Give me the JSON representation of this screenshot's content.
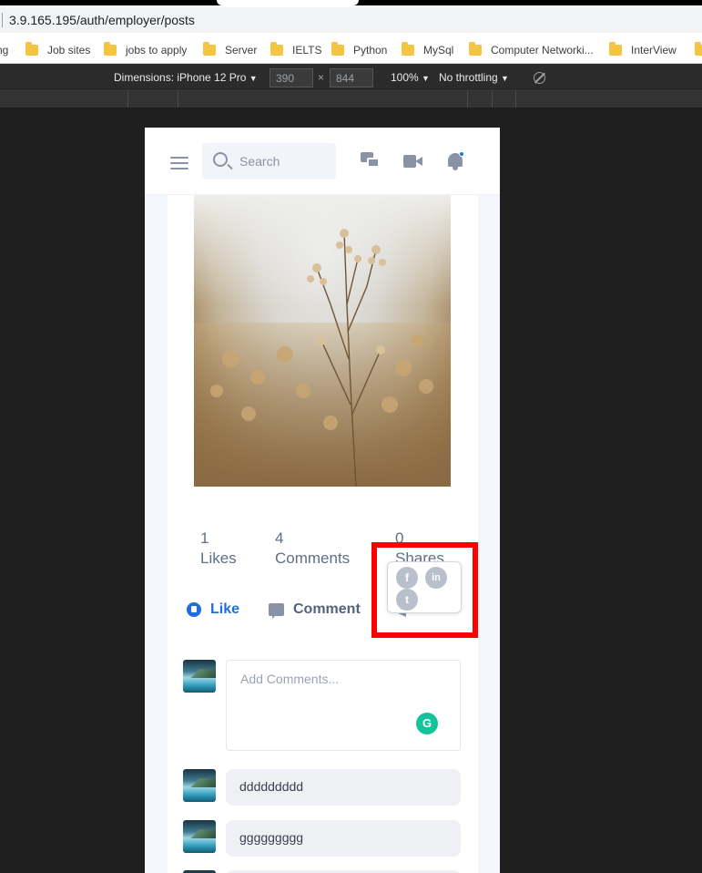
{
  "browser": {
    "url": "3.9.165.195/auth/employer/posts",
    "bookmarks": [
      {
        "label": "ng"
      },
      {
        "label": "Job sites"
      },
      {
        "label": "jobs to apply"
      },
      {
        "label": "Server"
      },
      {
        "label": "IELTS"
      },
      {
        "label": "Python"
      },
      {
        "label": "MySql"
      },
      {
        "label": "Computer Networki..."
      },
      {
        "label": "InterView"
      }
    ]
  },
  "devtools": {
    "dimensions_label": "Dimensions: iPhone 12 Pro",
    "width": "390",
    "height": "844",
    "times": "×",
    "zoom": "100%",
    "throttling": "No throttling",
    "caret": "▼"
  },
  "app": {
    "search_placeholder": "Search",
    "notification_accent": "#1e74e8"
  },
  "post": {
    "stats": {
      "likes_count": "1",
      "likes_label": "Likes",
      "comments_count": "4",
      "comments_label": "Comments",
      "shares_count": "0",
      "shares_label": "Shares"
    },
    "actions": {
      "like": "Like",
      "comment": "Comment",
      "share": "Share"
    },
    "share_options": [
      {
        "icon": "facebook-icon",
        "glyph": "f"
      },
      {
        "icon": "linkedin-icon",
        "glyph": "in"
      },
      {
        "icon": "twitter-icon",
        "glyph": "t"
      }
    ],
    "comment_placeholder": "Add Comments...",
    "comments": [
      {
        "text": "ddddddddd"
      },
      {
        "text": "ggggggggg"
      }
    ]
  },
  "colors": {
    "highlight": "#ff0000",
    "like_blue": "#1e6fd9"
  }
}
